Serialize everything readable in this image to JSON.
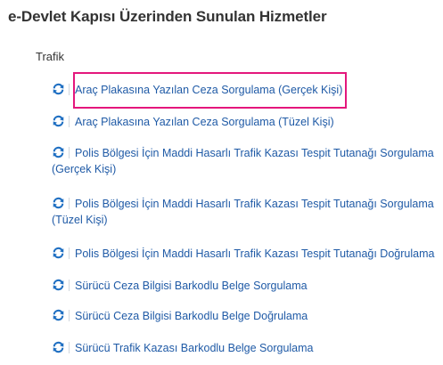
{
  "page": {
    "title": "e-Devlet Kapısı Üzerinden Sunulan Hizmetler"
  },
  "section": {
    "category": "Trafik"
  },
  "icon": {
    "name": "refresh-icon",
    "color": "#1f6fc2"
  },
  "highlight": {
    "color": "#e4177c"
  },
  "services": [
    {
      "label": "Araç Plakasına Yazılan Ceza Sorgulama (Gerçek Kişi)",
      "highlighted": true
    },
    {
      "label": "Araç Plakasına Yazılan Ceza Sorgulama (Tüzel Kişi)"
    },
    {
      "label": "Polis Bölgesi İçin Maddi Hasarlı Trafik Kazası Tespit Tutanağı Sorgulama (Gerçek Kişi)"
    },
    {
      "label": "Polis Bölgesi İçin Maddi Hasarlı Trafik Kazası Tespit Tutanağı Sorgulama (Tüzel Kişi)"
    },
    {
      "label": "Polis Bölgesi İçin Maddi Hasarlı Trafik Kazası Tespit Tutanağı Doğrulama"
    },
    {
      "label": "Sürücü Ceza Bilgisi Barkodlu Belge Sorgulama"
    },
    {
      "label": "Sürücü Ceza Bilgisi Barkodlu Belge Doğrulama"
    },
    {
      "label": "Sürücü Trafik Kazası Barkodlu Belge Sorgulama"
    }
  ]
}
